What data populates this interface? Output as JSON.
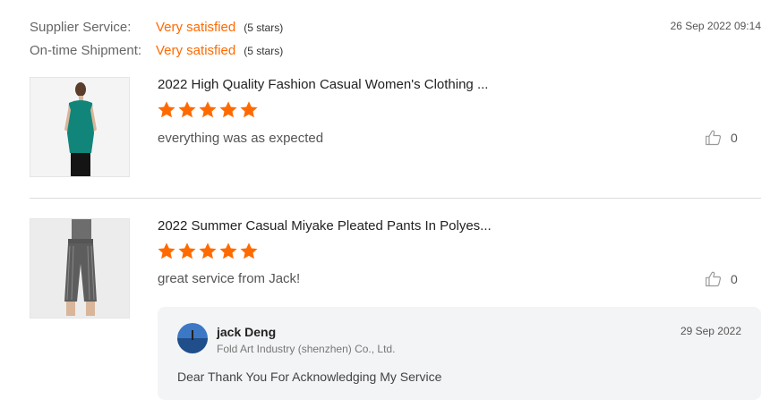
{
  "ratings": {
    "supplier_service": {
      "label": "Supplier Service:",
      "value": "Very satisfied",
      "note": "(5 stars)"
    },
    "on_time_shipment": {
      "label": "On-time Shipment:",
      "value": "Very satisfied",
      "note": "(5 stars)"
    },
    "date": "26 Sep 2022 09:14"
  },
  "reviews": [
    {
      "product_title": "2022 High Quality Fashion Casual Women's Clothing ...",
      "stars": 5,
      "comment": "everything was as expected",
      "likes": "0",
      "image_icon": "green-sleeveless-top-model-photo"
    },
    {
      "product_title": "2022 Summer Casual Miyake Pleated Pants In Polyes...",
      "stars": 5,
      "comment": "great service from Jack!",
      "likes": "0",
      "image_icon": "gray-pleated-pants-model-photo",
      "reply": {
        "name": "jack Deng",
        "company": "Fold Art Industry (shenzhen) Co., Ltd.",
        "date": "29 Sep 2022",
        "text": "Dear Thank You For Acknowledging My Service"
      }
    }
  ],
  "colors": {
    "accent": "#ff6a00",
    "reply_bg": "#f3f4f6",
    "divider": "#dcdcdc"
  }
}
